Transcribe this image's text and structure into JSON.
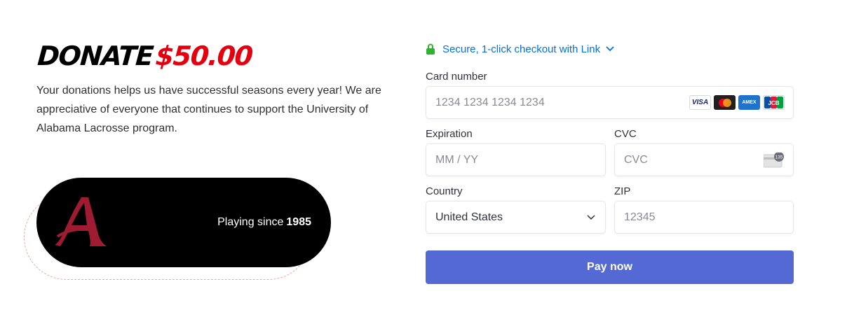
{
  "donation": {
    "title_word": "DONATE",
    "amount": "$50.00",
    "description": "Your donations helps us have successful seasons every year! We are appreciative of everyone that continues to support the University of Alabama Lacrosse program.",
    "badge_text": "Playing since",
    "badge_year": "1985"
  },
  "checkout": {
    "link_text": "Secure, 1-click checkout with Link",
    "card_number_label": "Card number",
    "card_number_placeholder": "1234 1234 1234 1234",
    "card_brands": [
      "visa",
      "mastercard",
      "amex",
      "jcb"
    ],
    "expiration_label": "Expiration",
    "expiration_placeholder": "MM / YY",
    "cvc_label": "CVC",
    "cvc_placeholder": "CVC",
    "cvc_icon_text": "135",
    "country_label": "Country",
    "country_value": "United States",
    "zip_label": "ZIP",
    "zip_placeholder": "12345",
    "pay_label": "Pay now"
  },
  "colors": {
    "amount_red": "#e3000f",
    "link_blue": "#0570de",
    "lock_green": "#30b130",
    "pay_button": "#5469d4",
    "crimson_logo": "#9e1b32"
  }
}
